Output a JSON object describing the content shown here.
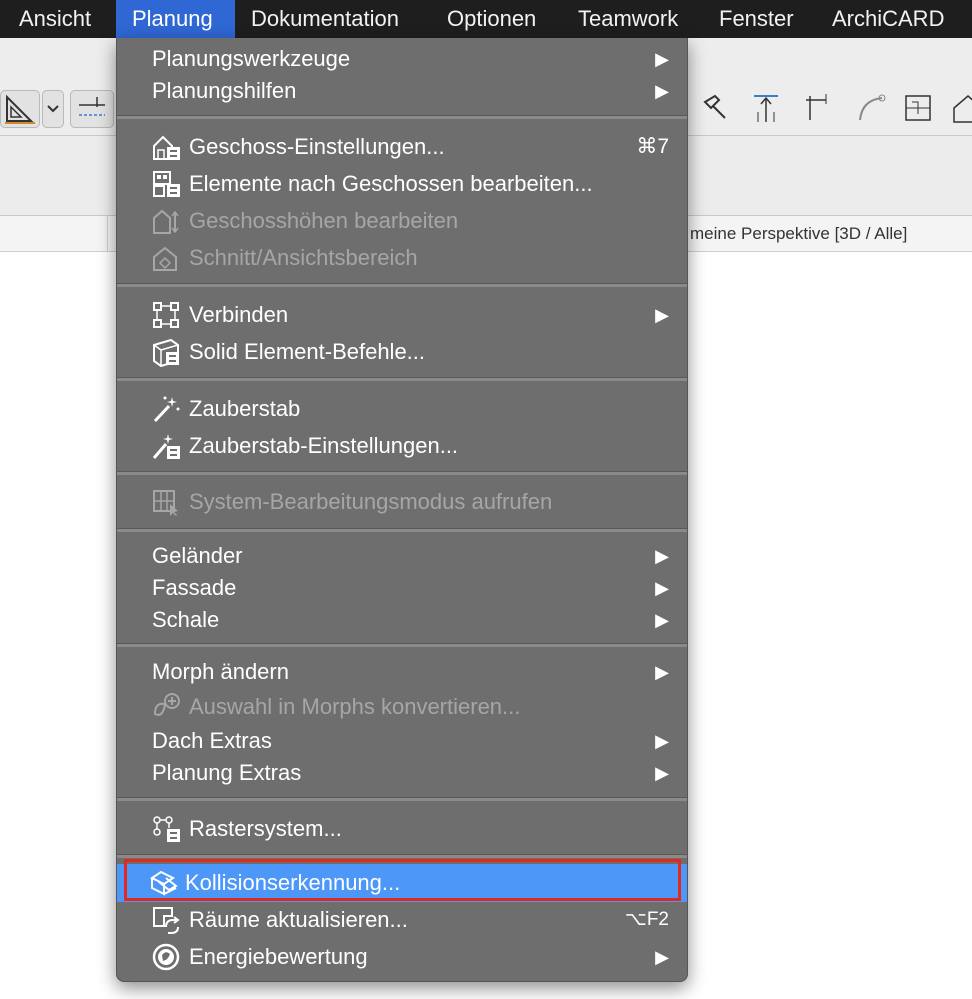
{
  "menubar": {
    "items": [
      "Ansicht",
      "Planung",
      "Dokumentation",
      "Optionen",
      "Teamwork",
      "Fenster",
      "ArchiCARD"
    ]
  },
  "tab": {
    "label": "meine Perspektive [3D / Alle]"
  },
  "menu": {
    "items": [
      {
        "label": "Planungswerkzeuge",
        "submenu": true
      },
      {
        "label": "Planungshilfen",
        "submenu": true
      },
      {
        "label": "Geschoss-Einstellungen...",
        "shortcut": "⌘7",
        "icon": "storey-settings-icon"
      },
      {
        "label": "Elemente nach Geschossen bearbeiten...",
        "icon": "edit-by-storey-icon"
      },
      {
        "label": "Geschosshöhen bearbeiten",
        "icon": "storey-heights-icon",
        "disabled": true
      },
      {
        "label": "Schnitt/Ansichtsbereich",
        "icon": "section-range-icon",
        "disabled": true
      },
      {
        "label": "Verbinden",
        "submenu": true,
        "icon": "connect-icon"
      },
      {
        "label": "Solid Element-Befehle...",
        "icon": "solid-element-icon"
      },
      {
        "label": "Zauberstab",
        "icon": "magic-wand-icon"
      },
      {
        "label": "Zauberstab-Einstellungen...",
        "icon": "magic-wand-settings-icon"
      },
      {
        "label": "System-Bearbeitungsmodus aufrufen",
        "icon": "system-edit-icon",
        "disabled": true
      },
      {
        "label": "Geländer",
        "submenu": true
      },
      {
        "label": "Fassade",
        "submenu": true
      },
      {
        "label": "Schale",
        "submenu": true
      },
      {
        "label": "Morph ändern",
        "submenu": true
      },
      {
        "label": "Auswahl in Morphs konvertieren...",
        "icon": "convert-morph-icon",
        "disabled": true
      },
      {
        "label": "Dach Extras",
        "submenu": true
      },
      {
        "label": "Planung Extras",
        "submenu": true
      },
      {
        "label": "Rastersystem...",
        "icon": "grid-system-icon"
      },
      {
        "label": "Kollisionserkennung...",
        "icon": "collision-detection-icon",
        "highlighted": true
      },
      {
        "label": "Räume aktualisieren...",
        "shortcut": "⌥F2",
        "icon": "update-zones-icon"
      },
      {
        "label": "Energiebewertung",
        "submenu": true,
        "icon": "energy-evaluation-icon"
      }
    ]
  },
  "colors": {
    "menu_bg": "#6e6e6e",
    "highlight": "#4c97f7",
    "active_menubar": "#2f67d4",
    "annotation": "#e3281c"
  }
}
